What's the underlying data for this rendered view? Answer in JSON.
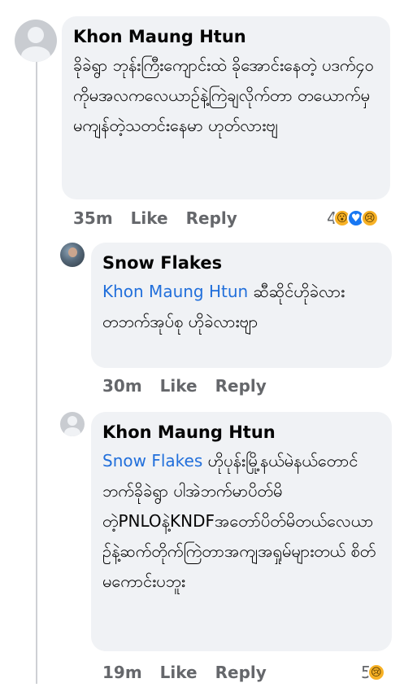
{
  "comments": [
    {
      "author": "Khon Maung Htun",
      "mention": "",
      "text": "ခိုခဲရွာ ဘုန်းကြီးကျောင်းထဲ ခိုအောင်းနေတဲ့ ပဒက်၄၀ ကိုမအလကလေယာဥ်နဲ့ကြဲချလိုက်တာ တယောက်မှမကျန်တဲ့သတင်းနေမာ ဟုတ်လားဗျ",
      "time": "35m",
      "like_label": "Like",
      "reply_label": "Reply",
      "reaction_count": "4",
      "reactions": [
        "wow-icon",
        "care-icon",
        "sad-icon"
      ]
    },
    {
      "author": "Snow Flakes",
      "mention": "Khon Maung Htun",
      "text": "ဆီဆိုင်ဟိုခဲလား တဘက်အုပ်စု ဟိုခဲလားဗျာ",
      "time": "30m",
      "like_label": "Like",
      "reply_label": "Reply",
      "reaction_count": "",
      "reactions": []
    },
    {
      "author": "Khon Maung Htun",
      "mention": "Snow Flakes",
      "text": "ဟိုပုန်းမြို့နယ်မဲနယ်တောင်ဘက်ခိုခဲရွာ ပါအဲဘက်မာပိတ်မိတဲ့PNLOနဲ့KNDFအတော်ပိတ်မိတယ်လေယာဥ်နဲ့ဆက်တိုက်ကြဲတာအကျအရှုမ်များတယ် စိတ်မကောင်းပဘူး",
      "time": "19m",
      "like_label": "Like",
      "reply_label": "Reply",
      "reaction_count": "5",
      "reactions": [
        "sad-icon"
      ]
    }
  ]
}
